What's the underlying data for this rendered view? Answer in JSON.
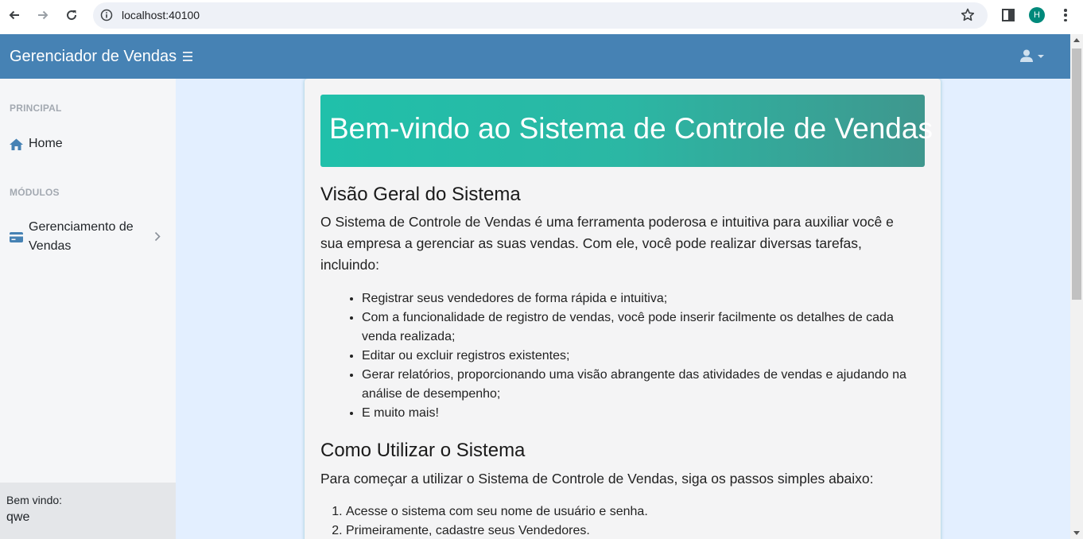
{
  "browser": {
    "url": "localhost:40100",
    "profile_initial": "H"
  },
  "navbar": {
    "brand": "Gerenciador de Vendas",
    "bg_color": "#4682b4"
  },
  "sidebar": {
    "sections": [
      {
        "heading": "PRINCIPAL",
        "items": [
          {
            "label": "Home",
            "icon": "home-icon"
          }
        ]
      },
      {
        "heading": "MÓDULOS",
        "items": [
          {
            "label": "Gerenciamento de",
            "label2": "Vendas",
            "icon": "credit-card-icon"
          }
        ]
      }
    ],
    "footer": {
      "welcome": "Bem vindo:",
      "user": "qwe"
    }
  },
  "content": {
    "hero_title": "Bem-vindo ao Sistema de Controle de Vendas",
    "overview": {
      "title": "Visão Geral do Sistema",
      "intro_lines": [
        "O Sistema de Controle de Vendas é uma ferramenta poderosa e intuitiva para auxiliar você e",
        "sua empresa a gerenciar as suas vendas. Com ele, você pode realizar diversas tarefas,",
        "incluindo:"
      ],
      "features": [
        [
          "Registrar seus vendedores de forma rápida e intuitiva;"
        ],
        [
          "Com a funcionalidade de registro de vendas, você pode inserir facilmente os detalhes de cada",
          "venda realizada;"
        ],
        [
          "Editar ou excluir registros existentes;"
        ],
        [
          "Gerar relatórios, proporcionando uma visão abrangente das atividades de vendas e ajudando na",
          "análise de desempenho;"
        ],
        [
          "E muito mais!"
        ]
      ]
    },
    "usage": {
      "title": "Como Utilizar o Sistema",
      "intro": "Para começar a utilizar o Sistema de Controle de Vendas, siga os passos simples abaixo:",
      "steps": [
        "Acesse o sistema com seu nome de usuário e senha.",
        "Primeiramente, cadastre seus Vendedores."
      ]
    }
  }
}
